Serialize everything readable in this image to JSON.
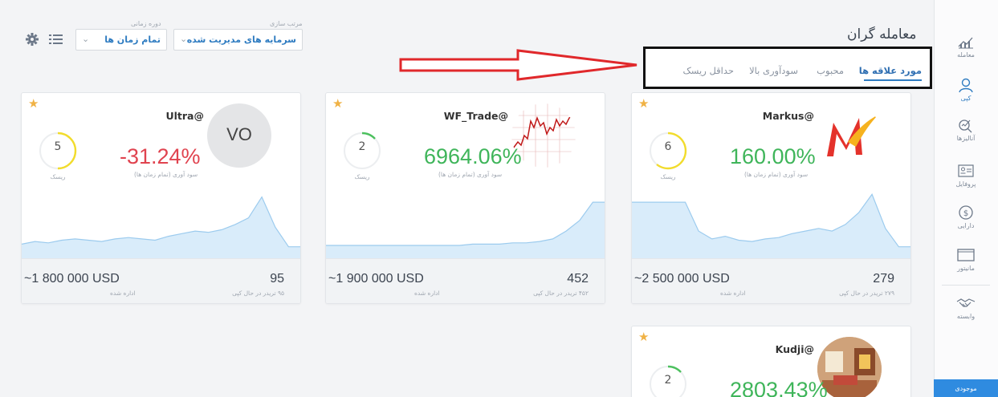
{
  "header": {
    "title": "معامله گران",
    "sort_label": "مرتب سازی",
    "sort_value": "سرمایه های مدیریت شده",
    "period_label": "دوره زمانی",
    "period_value": "تمام زمان ها"
  },
  "tabs": [
    {
      "label": "مورد علاقه ها",
      "active": true
    },
    {
      "label": "محبوب",
      "active": false
    },
    {
      "label": "سودآوری بالا",
      "active": false
    },
    {
      "label": "حداقل ریسک",
      "active": false
    }
  ],
  "sidebar": {
    "items": [
      {
        "label": "معامله",
        "icon": "chart-icon"
      },
      {
        "label": "کپی",
        "icon": "user-icon"
      },
      {
        "label": "آنالیزها",
        "icon": "analytics-icon"
      },
      {
        "label": "پروفایل",
        "icon": "profile-card-icon"
      },
      {
        "label": "دارایی",
        "icon": "dollar-icon"
      },
      {
        "label": "مانیتور",
        "icon": "monitor-icon"
      },
      {
        "label": "وابسته",
        "icon": "handshake-icon"
      }
    ],
    "bottom_label": "موجودی"
  },
  "common": {
    "risk_label": "ریسک",
    "profit_label": "سود آوری (تمام زمان ها)",
    "managed_label": "اداره شده"
  },
  "traders": [
    {
      "username": "Ultra@",
      "avatar_text": "VO",
      "avatar_type": "initials",
      "risk": "5",
      "profit": "-31.24%",
      "profit_positive": false,
      "managed": "~1 800 000 USD",
      "investors": "95",
      "investors_label": "۹۵ تریدر در حال کپی",
      "sparkline": [
        48,
        46,
        47,
        45,
        44,
        45,
        46,
        44,
        43,
        44,
        45,
        42,
        40,
        38,
        39,
        37,
        33,
        28,
        12,
        35,
        50,
        50
      ]
    },
    {
      "username": "WF_Trade@",
      "avatar_type": "chart",
      "risk": "2",
      "profit": "6964.06%",
      "profit_positive": true,
      "managed": "~1 900 000 USD",
      "investors": "452",
      "investors_label": "۴۵۲ تریدر در حال کپی",
      "sparkline": [
        49,
        49,
        49,
        49,
        49,
        49,
        49,
        49,
        49,
        49,
        49,
        48,
        48,
        48,
        47,
        47,
        46,
        44,
        38,
        30,
        16,
        16
      ]
    },
    {
      "username": "Markus@",
      "avatar_type": "logo",
      "risk": "6",
      "profit": "160.00%",
      "profit_positive": true,
      "managed": "~2 500 000 USD",
      "investors": "279",
      "investors_label": "۲۷۹ تریدر در حال کپی",
      "sparkline": [
        16,
        16,
        16,
        16,
        16,
        38,
        44,
        42,
        45,
        46,
        44,
        43,
        40,
        38,
        36,
        38,
        33,
        24,
        10,
        36,
        50,
        50
      ]
    },
    {
      "username": "Kudji@",
      "avatar_type": "photo",
      "risk": "2",
      "profit": "2803.43%",
      "profit_positive": true
    }
  ]
}
